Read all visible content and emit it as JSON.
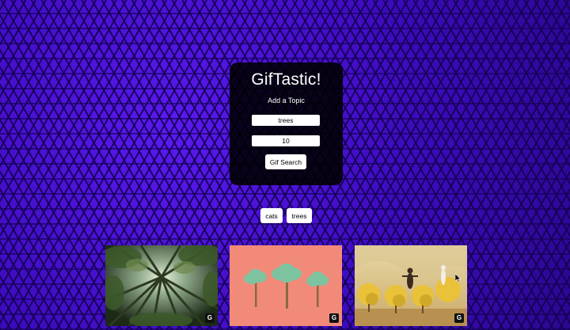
{
  "app": {
    "title": "GifTastic!",
    "subtitle": "Add a Topic"
  },
  "form": {
    "topic_value": "trees",
    "limit_value": "10",
    "search_label": "Gif Search"
  },
  "topics": [
    {
      "label": "cats"
    },
    {
      "label": "trees"
    }
  ],
  "results": [
    {
      "badge": "G",
      "content": "bamboo-forest-gif"
    },
    {
      "badge": "G",
      "content": "cartoon-trees-gif"
    },
    {
      "badge": "G",
      "content": "dancers-with-trees-gif"
    }
  ],
  "colors": {
    "background": "#3a0ab8",
    "panel": "#000000",
    "button": "#ffffff",
    "gif2_bg": "#f28a7a"
  }
}
